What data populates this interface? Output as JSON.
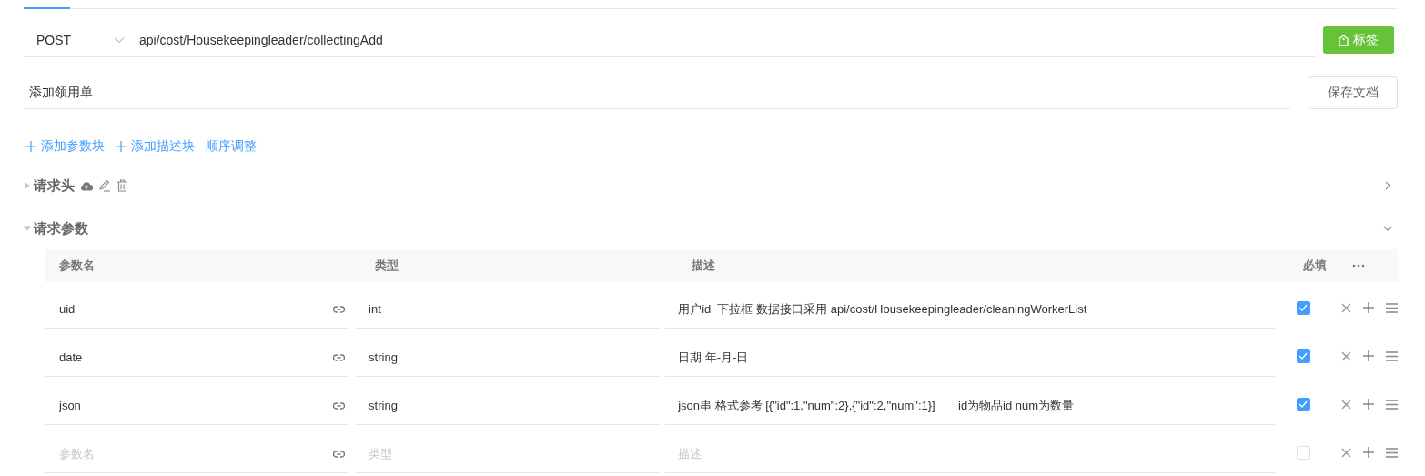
{
  "request": {
    "method": "POST",
    "url": "api/cost/Housekeepingleader/collectingAdd"
  },
  "tag_button": "标签",
  "title_field": {
    "value": "添加领用单"
  },
  "save_button": "保存文档",
  "links": [
    {
      "label": "添加参数块",
      "kind": "add"
    },
    {
      "label": "添加描述块",
      "kind": "add"
    },
    {
      "label": "顺序调整",
      "kind": "plain"
    }
  ],
  "sections": [
    {
      "title": "请求头",
      "expanded": false,
      "actions": true
    },
    {
      "title": "请求参数",
      "expanded": true,
      "actions": false
    }
  ],
  "table": {
    "columns": [
      "参数名",
      "类型",
      "描述",
      "必填"
    ],
    "rows": [
      {
        "name": {
          "value": "uid"
        },
        "type": {
          "value": "int"
        },
        "description": {
          "value": "用户id  下拉框 数据接口采用 api/cost/Housekeepingleader/cleaningWorkerList"
        },
        "required": true
      },
      {
        "name": {
          "value": "date"
        },
        "type": {
          "value": "string"
        },
        "description": {
          "value": "日期 年-月-日"
        },
        "required": true
      },
      {
        "name": {
          "value": "json"
        },
        "type": {
          "value": "string"
        },
        "description": {
          "value": "json串 格式参考 [{\"id\":1,\"num\":2},{\"id\":2,\"num\":1}]       id为物品id num为数量"
        },
        "required": true
      },
      {
        "name": {
          "placeholder": "参数名"
        },
        "type": {
          "placeholder": "类型"
        },
        "description": {
          "placeholder": "描述"
        },
        "required": false
      }
    ]
  }
}
